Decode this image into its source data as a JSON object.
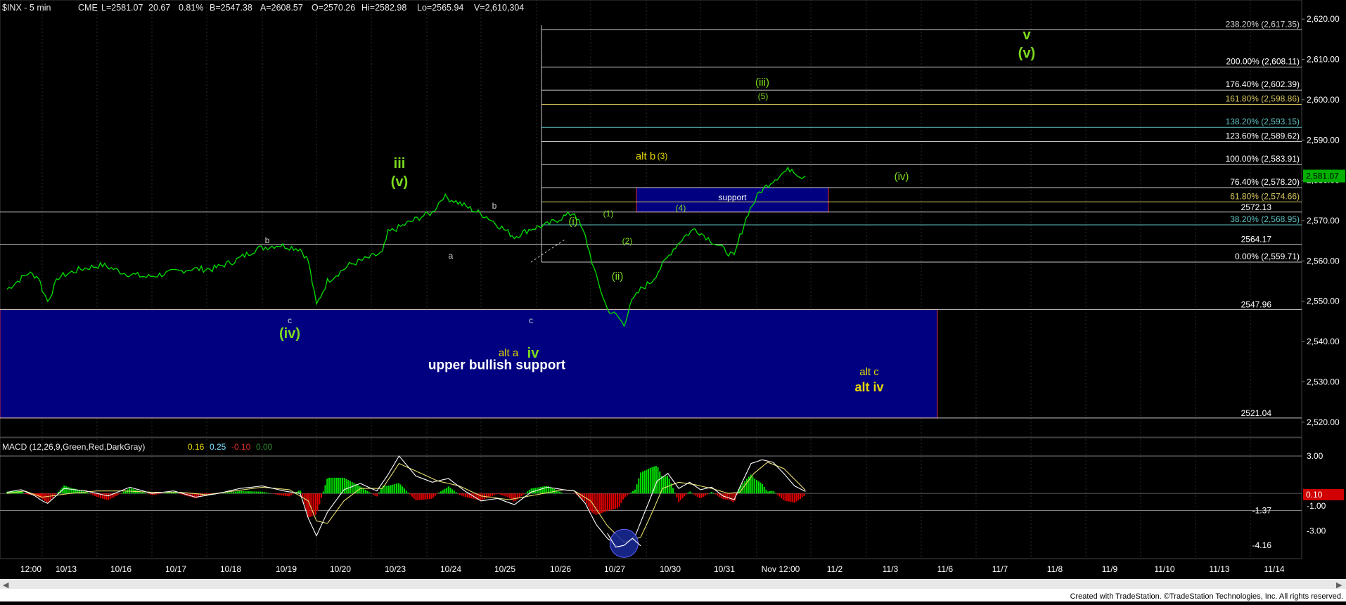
{
  "header": {
    "symbol": "$INX - 5 min",
    "exchange": "CME",
    "last": "L=2581.07",
    "change": "20.67",
    "change_pct": "0.81%",
    "bid": "B=2547.38",
    "ask": "A=2608.57",
    "open": "O=2570.26",
    "high": "Hi=2582.98",
    "low": "Lo=2565.94",
    "volume": "V=2,610,304"
  },
  "colors": {
    "background": "#000000",
    "price_line": "#00e000",
    "fib_line": "#c8c8c8",
    "fib_text": "#ffffff",
    "fib_gold": "#d8c860",
    "fib_teal": "#60c0c0",
    "zone_fill": "#000080",
    "zone_border": "#e03030",
    "wave_green": "#7ddc1f",
    "wave_yellow": "#e8d800",
    "wave_white": "#d0d0d0",
    "macd_line": "#ffffff",
    "signal_line": "#e8e070",
    "hist_pos": "#00e000",
    "hist_neg": "#e00000"
  },
  "chart_data": [
    {
      "type": "line",
      "series": [
        {
          "name": "$INX - 5 min"
        }
      ],
      "ylim": [
        2517,
        2623
      ],
      "y_ticks": [
        "2,620.00",
        "2,610.00",
        "2,600.00",
        "2,590.00",
        "2,580.00",
        "2,570.00",
        "2,560.00",
        "2,550.00",
        "2,540.00",
        "2,530.00",
        "2,520.00"
      ],
      "y_tick_values": [
        2620,
        2610,
        2600,
        2590,
        2580,
        2570,
        2560,
        2550,
        2540,
        2530,
        2520
      ],
      "last_price_label": "2,581.07",
      "last_price": 2581.07,
      "x_tick_labels": [
        "12:00",
        "10/13",
        "10/16",
        "10/17",
        "10/18",
        "10/19",
        "10/20",
        "10/23",
        "10/24",
        "10/25",
        "10/26",
        "10/27",
        "10/30",
        "10/31",
        "Nov 12:00",
        "11/2",
        "11/3",
        "11/6",
        "11/7",
        "11/8",
        "11/9",
        "11/10",
        "11/13",
        "11/14"
      ],
      "price_path": [
        [
          0,
          2553
        ],
        [
          0.3,
          2555
        ],
        [
          0.6,
          2557
        ],
        [
          0.9,
          2556
        ],
        [
          1.1,
          2550
        ],
        [
          1.3,
          2556
        ],
        [
          1.7,
          2558
        ],
        [
          2.1,
          2559
        ],
        [
          2.5,
          2557
        ],
        [
          2.9,
          2556
        ],
        [
          3.3,
          2557
        ],
        [
          3.7,
          2558
        ],
        [
          4.1,
          2558
        ],
        [
          4.5,
          2560
        ],
        [
          4.9,
          2563
        ],
        [
          5.3,
          2564
        ],
        [
          5.7,
          2563
        ],
        [
          5.85,
          2560
        ],
        [
          6.0,
          2549
        ],
        [
          6.2,
          2555
        ],
        [
          6.6,
          2559
        ],
        [
          7.0,
          2561
        ],
        [
          7.2,
          2562
        ],
        [
          7.3,
          2567
        ],
        [
          7.6,
          2569
        ],
        [
          7.9,
          2571
        ],
        [
          8.1,
          2572
        ],
        [
          8.3,
          2576
        ],
        [
          8.5,
          2575
        ],
        [
          8.8,
          2573
        ],
        [
          9.1,
          2571
        ],
        [
          9.3,
          2569
        ],
        [
          9.6,
          2566
        ],
        [
          9.9,
          2568
        ],
        [
          10.2,
          2569
        ],
        [
          10.5,
          2571
        ],
        [
          10.7,
          2572
        ],
        [
          10.9,
          2566
        ],
        [
          11.1,
          2556
        ],
        [
          11.3,
          2548
        ],
        [
          11.5,
          2546
        ],
        [
          11.6,
          2544
        ],
        [
          11.7,
          2549
        ],
        [
          11.9,
          2553
        ],
        [
          12.1,
          2555
        ],
        [
          12.3,
          2559
        ],
        [
          12.5,
          2563
        ],
        [
          12.7,
          2566
        ],
        [
          12.9,
          2568
        ],
        [
          13.1,
          2566
        ],
        [
          13.3,
          2564
        ],
        [
          13.5,
          2562
        ],
        [
          13.6,
          2561
        ],
        [
          13.7,
          2566
        ],
        [
          13.85,
          2572
        ],
        [
          14.05,
          2577
        ],
        [
          14.3,
          2580
        ],
        [
          14.5,
          2582
        ],
        [
          14.65,
          2582.98
        ],
        [
          14.8,
          2581
        ],
        [
          14.9,
          2581.07
        ]
      ],
      "fib_levels": [
        {
          "label": "238.20% (2,617.35)",
          "value": 2617.35,
          "color": "#d0d0d0"
        },
        {
          "label": "200.00% (2,608.11)",
          "value": 2608.11,
          "color": "#ffffff"
        },
        {
          "label": "176.40% (2,602.39)",
          "value": 2602.39,
          "color": "#ffffff"
        },
        {
          "label": "161.80% (2,598.86)",
          "value": 2598.86,
          "color": "#d8c860"
        },
        {
          "label": "138.20% (2,593.15)",
          "value": 2593.15,
          "color": "#60c0c0"
        },
        {
          "label": "123.60% (2,589.62)",
          "value": 2589.62,
          "color": "#ffffff"
        },
        {
          "label": "100.00% (2,583.91)",
          "value": 2583.91,
          "color": "#ffffff"
        },
        {
          "label": "76.40% (2,578.20)",
          "value": 2578.2,
          "color": "#ffffff"
        },
        {
          "label": "61.80% (2,574.66)",
          "value": 2574.66,
          "color": "#d8c860"
        },
        {
          "label": "38.20% (2,568.95)",
          "value": 2568.95,
          "color": "#60c0c0"
        },
        {
          "label": "0.00% (2,559.71)",
          "value": 2559.71,
          "color": "#ffffff"
        }
      ],
      "price_lines": [
        {
          "label": "2572.13",
          "value": 2572.13
        },
        {
          "label": "2564.17",
          "value": 2564.17
        },
        {
          "label": "2547.96",
          "value": 2547.96
        },
        {
          "label": "2521.04",
          "value": 2521.04
        }
      ],
      "zones": [
        {
          "label": "support",
          "top": 2578.2,
          "bottom": 2572.13
        },
        {
          "label": "upper bullish support",
          "top": 2547.96,
          "bottom": 2521.04
        }
      ],
      "wave_labels": [
        {
          "text": "v",
          "color": "#7ddc1f",
          "size": "big"
        },
        {
          "text": "(v)",
          "color": "#7ddc1f",
          "size": "big"
        },
        {
          "text": "(iii)",
          "color": "#7ddc1f",
          "size": "mid"
        },
        {
          "text": "(5)",
          "color": "#7ddc1f",
          "size": "small"
        },
        {
          "text": "alt b",
          "color": "#e8d800",
          "size": "mid"
        },
        {
          "text": "(3)",
          "color": "#e8d800",
          "size": "small"
        },
        {
          "text": "(iv)",
          "color": "#7ddc1f",
          "size": "mid"
        },
        {
          "text": "(4)",
          "color": "#7ddc1f",
          "size": "small"
        },
        {
          "text": "(1)",
          "color": "#7ddc1f",
          "size": "small"
        },
        {
          "text": "(2)",
          "color": "#7ddc1f",
          "size": "small"
        },
        {
          "text": "(i)",
          "color": "#7ddc1f",
          "size": "mid"
        },
        {
          "text": "(ii)",
          "color": "#7ddc1f",
          "size": "mid"
        },
        {
          "text": "iii",
          "color": "#7ddc1f",
          "size": "big"
        },
        {
          "text": "(v)",
          "color": "#7ddc1f",
          "size": "big"
        },
        {
          "text": "b",
          "color": "#d0d0d0",
          "size": "small"
        },
        {
          "text": "a",
          "color": "#d0d0d0",
          "size": "small"
        },
        {
          "text": "b",
          "color": "#d0d0d0",
          "size": "small"
        },
        {
          "text": "c",
          "color": "#d0d0d0",
          "size": "small"
        },
        {
          "text": "(iv)",
          "color": "#7ddc1f",
          "size": "big"
        },
        {
          "text": "c",
          "color": "#d0d0d0",
          "size": "small"
        },
        {
          "text": "alt a",
          "color": "#e8d800",
          "size": "mid"
        },
        {
          "text": "iv",
          "color": "#7ddc1f",
          "size": "big"
        },
        {
          "text": "alt c",
          "color": "#e8d800",
          "size": "mid"
        },
        {
          "text": "alt iv",
          "color": "#e8d800",
          "size": "bigbold"
        }
      ]
    },
    {
      "type": "line",
      "title": "MACD (12,26,9,Green,Red,DarkGray)",
      "indicator_values": [
        {
          "text": "0.16",
          "color": "#e8d800"
        },
        {
          "text": "0.25",
          "color": "#7ee0ff"
        },
        {
          "text": "-0.10",
          "color": "#e03030"
        },
        {
          "text": "0.00",
          "color": "#2e8b2e"
        }
      ],
      "ylim": [
        -5.0,
        3.9
      ],
      "y_ticks": [
        "3.00",
        "-1.00",
        "-3.00"
      ],
      "y_tick_values": [
        3.0,
        -1.0,
        -3.0
      ],
      "level_labels": [
        {
          "label": "-1.37",
          "value": -1.37
        },
        {
          "label": "-4.16",
          "value": -4.16
        }
      ],
      "last_value_label": "0.10",
      "last_value": -0.1,
      "macd_path": [
        [
          0,
          0.1
        ],
        [
          0.4,
          0.3
        ],
        [
          0.8,
          -0.2
        ],
        [
          1.1,
          -0.8
        ],
        [
          1.4,
          0.4
        ],
        [
          1.8,
          0.2
        ],
        [
          2.2,
          -0.2
        ],
        [
          2.6,
          0.5
        ],
        [
          3.0,
          0.0
        ],
        [
          3.4,
          0.2
        ],
        [
          3.8,
          -0.3
        ],
        [
          4.2,
          0.0
        ],
        [
          4.6,
          0.4
        ],
        [
          5.0,
          0.6
        ],
        [
          5.4,
          0.2
        ],
        [
          5.7,
          0.0
        ],
        [
          5.85,
          -2.0
        ],
        [
          6.0,
          -3.4
        ],
        [
          6.2,
          -1.5
        ],
        [
          6.5,
          0.3
        ],
        [
          6.8,
          0.8
        ],
        [
          7.1,
          0.2
        ],
        [
          7.3,
          1.5
        ],
        [
          7.5,
          3.0
        ],
        [
          7.8,
          1.4
        ],
        [
          8.1,
          0.9
        ],
        [
          8.4,
          1.2
        ],
        [
          8.7,
          0.2
        ],
        [
          9.0,
          -0.6
        ],
        [
          9.3,
          -0.4
        ],
        [
          9.6,
          -0.9
        ],
        [
          9.9,
          0.1
        ],
        [
          10.2,
          0.5
        ],
        [
          10.5,
          0.3
        ],
        [
          10.7,
          0.2
        ],
        [
          10.9,
          -0.8
        ],
        [
          11.1,
          -2.5
        ],
        [
          11.3,
          -3.6
        ],
        [
          11.5,
          -4.3
        ],
        [
          11.6,
          -4.16
        ],
        [
          11.8,
          -3.4
        ],
        [
          12.0,
          -1.2
        ],
        [
          12.2,
          1.0
        ],
        [
          12.4,
          1.6
        ],
        [
          12.6,
          0.4
        ],
        [
          12.8,
          0.9
        ],
        [
          13.0,
          0.3
        ],
        [
          13.2,
          0.5
        ],
        [
          13.4,
          -0.2
        ],
        [
          13.6,
          -0.5
        ],
        [
          13.7,
          0.5
        ],
        [
          13.9,
          2.4
        ],
        [
          14.1,
          2.7
        ],
        [
          14.3,
          2.5
        ],
        [
          14.5,
          1.6
        ],
        [
          14.7,
          0.6
        ],
        [
          14.9,
          0.16
        ]
      ],
      "signal_path": [
        [
          0,
          0.0
        ],
        [
          0.5,
          0.2
        ],
        [
          1.0,
          -0.3
        ],
        [
          1.5,
          0.0
        ],
        [
          2.0,
          0.2
        ],
        [
          2.5,
          0.2
        ],
        [
          3.0,
          0.1
        ],
        [
          3.5,
          0.1
        ],
        [
          4.0,
          -0.1
        ],
        [
          4.5,
          0.2
        ],
        [
          5.0,
          0.5
        ],
        [
          5.5,
          0.3
        ],
        [
          5.85,
          -0.6
        ],
        [
          6.0,
          -2.2
        ],
        [
          6.2,
          -2.4
        ],
        [
          6.5,
          -0.6
        ],
        [
          6.8,
          0.4
        ],
        [
          7.2,
          0.4
        ],
        [
          7.5,
          2.4
        ],
        [
          7.8,
          1.8
        ],
        [
          8.2,
          1.0
        ],
        [
          8.6,
          0.6
        ],
        [
          9.0,
          -0.2
        ],
        [
          9.5,
          -0.5
        ],
        [
          10.0,
          -0.1
        ],
        [
          10.5,
          0.3
        ],
        [
          10.7,
          0.2
        ],
        [
          11.0,
          -0.6
        ],
        [
          11.3,
          -2.6
        ],
        [
          11.6,
          -3.9
        ],
        [
          11.9,
          -3.5
        ],
        [
          12.1,
          -1.6
        ],
        [
          12.3,
          0.4
        ],
        [
          12.6,
          0.9
        ],
        [
          12.9,
          0.7
        ],
        [
          13.2,
          0.4
        ],
        [
          13.5,
          0.0
        ],
        [
          13.7,
          0.1
        ],
        [
          13.95,
          1.6
        ],
        [
          14.2,
          2.5
        ],
        [
          14.5,
          2.0
        ],
        [
          14.8,
          0.7
        ],
        [
          14.9,
          0.25
        ]
      ]
    }
  ],
  "footer": {
    "credit": "Created with TradeStation. ©TradeStation Technologies, Inc. All rights reserved."
  }
}
